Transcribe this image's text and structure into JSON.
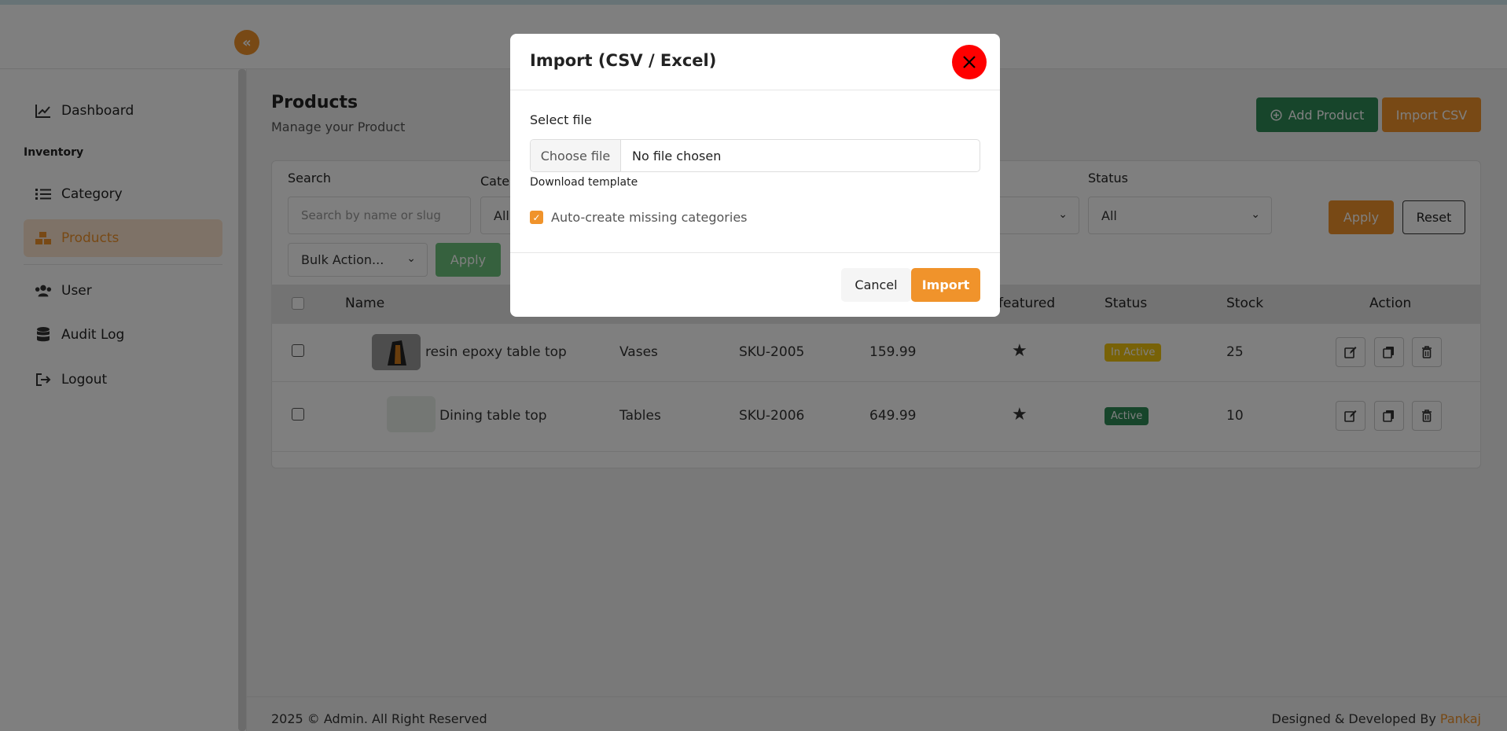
{
  "header": {
    "collapse_icon": "double-chevron-left-icon"
  },
  "sidebar": {
    "section_inventory": "Inventory",
    "items": [
      {
        "label": "Dashboard",
        "icon": "chart-line-icon"
      },
      {
        "label": "Category",
        "icon": "list-icon"
      },
      {
        "label": "Products",
        "icon": "boxes-icon",
        "active": true
      },
      {
        "label": "User",
        "icon": "users-icon"
      },
      {
        "label": "Audit Log",
        "icon": "database-icon"
      },
      {
        "label": "Logout",
        "icon": "sign-out-icon"
      }
    ]
  },
  "page": {
    "title": "Products",
    "subtitle": "Manage your Product",
    "add_button": "Add Product",
    "import_button": "Import CSV"
  },
  "filters": {
    "search_label": "Search",
    "search_placeholder": "Search by name or slug",
    "category_label": "Categ",
    "category_value": "All",
    "status_label": "Status",
    "status_value": "All",
    "apply_label": "Apply",
    "reset_label": "Reset",
    "bulk_action_value": "Bulk Action...",
    "bulk_apply_label": "Apply"
  },
  "table": {
    "columns": [
      "Name",
      "featured",
      "Status",
      "Stock",
      "Action"
    ],
    "rows": [
      {
        "name": "resin epoxy table top",
        "category": "Vases",
        "sku": "SKU-2005",
        "price": "159.99",
        "status": "In Active",
        "stock": "25"
      },
      {
        "name": "Dining table top",
        "category": "Tables",
        "sku": "SKU-2006",
        "price": "649.99",
        "status": "Active",
        "stock": "10"
      }
    ]
  },
  "footer": {
    "copyright": "2025 © Admin. All Right Reserved",
    "credit_prefix": "Designed & Developed By",
    "credit_name": "Pankaj"
  },
  "modal": {
    "title": "Import (CSV / Excel)",
    "select_label": "Select file",
    "choose_file_label": "Choose file",
    "file_status": "No file chosen",
    "download_template": "Download template",
    "auto_create_label": "Auto-create missing categories",
    "auto_create_checked": true,
    "cancel_label": "Cancel",
    "import_label": "Import"
  },
  "colors": {
    "accent": "#f0932b",
    "success": "#2e8b57",
    "warning": "#f1c40f",
    "danger": "#ff0000"
  }
}
